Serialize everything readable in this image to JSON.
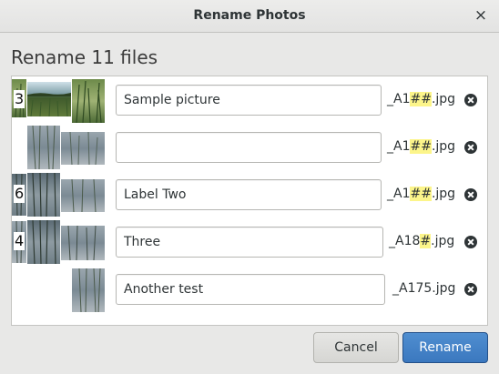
{
  "window": {
    "title": "Rename Photos",
    "close_icon": "×"
  },
  "heading": "Rename 11 files",
  "rows": [
    {
      "badge": "3",
      "value": "Sample picture",
      "suffix_prefix": "_A1",
      "suffix_mark": "##",
      "suffix_end": ".jpg"
    },
    {
      "badge": "",
      "value": "",
      "suffix_prefix": "_A1",
      "suffix_mark": "##",
      "suffix_end": ".jpg"
    },
    {
      "badge": "6",
      "value": "Label Two",
      "suffix_prefix": "_A1",
      "suffix_mark": "##",
      "suffix_end": ".jpg"
    },
    {
      "badge": "4",
      "value": "Three",
      "suffix_prefix": "_A18",
      "suffix_mark": "#",
      "suffix_end": ".jpg"
    },
    {
      "badge": "",
      "value": "Another test",
      "suffix_prefix": "_A175.jpg",
      "suffix_mark": "",
      "suffix_end": ""
    }
  ],
  "buttons": {
    "cancel": "Cancel",
    "rename": "Rename"
  },
  "colors": {
    "accent": "#4a89cf",
    "highlight": "#fcf58a"
  }
}
